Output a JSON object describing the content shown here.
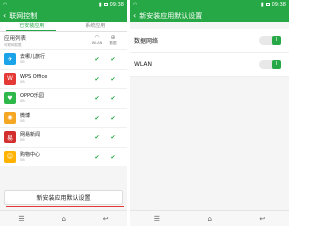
{
  "left": {
    "status": {
      "time": "09:38"
    },
    "title": "联网控制",
    "tabs": [
      "已安装应用",
      "系统应用"
    ],
    "list_header": {
      "title": "应用列表",
      "subtitle": "可联网权限",
      "col_wlan": "WLAN",
      "col_data": "数据"
    },
    "apps": [
      {
        "name": "去哪儿旅行",
        "size": "0B",
        "icon_color": "#1aa3e8",
        "icon": "✈"
      },
      {
        "name": "WPS Office",
        "size": "0B",
        "icon_color": "#e53935",
        "icon": "W"
      },
      {
        "name": "OPPO乐园",
        "size": "0B",
        "icon_color": "#2eb84a",
        "icon": "♥"
      },
      {
        "name": "微博",
        "size": "0B",
        "icon_color": "#f5a623",
        "icon": "◉"
      },
      {
        "name": "网易新闻",
        "size": "0B",
        "icon_color": "#d32f2f",
        "icon": "易"
      },
      {
        "name": "购物中心",
        "size": "0B",
        "icon_color": "#ffb300",
        "icon": "☺"
      }
    ],
    "bottom_button": "新安装应用默认设置",
    "nav": [
      "☰",
      "⌂",
      "↩"
    ]
  },
  "right": {
    "status": {
      "time": "09:38"
    },
    "title": "新安装应用默认设置",
    "settings": [
      {
        "label": "数据网络",
        "knob": "I"
      },
      {
        "label": "WLAN",
        "knob": "I"
      }
    ],
    "nav": [
      "☰",
      "⌂",
      "↩"
    ]
  },
  "colors": {
    "accent": "#27a846",
    "highlight": "#e53935"
  }
}
